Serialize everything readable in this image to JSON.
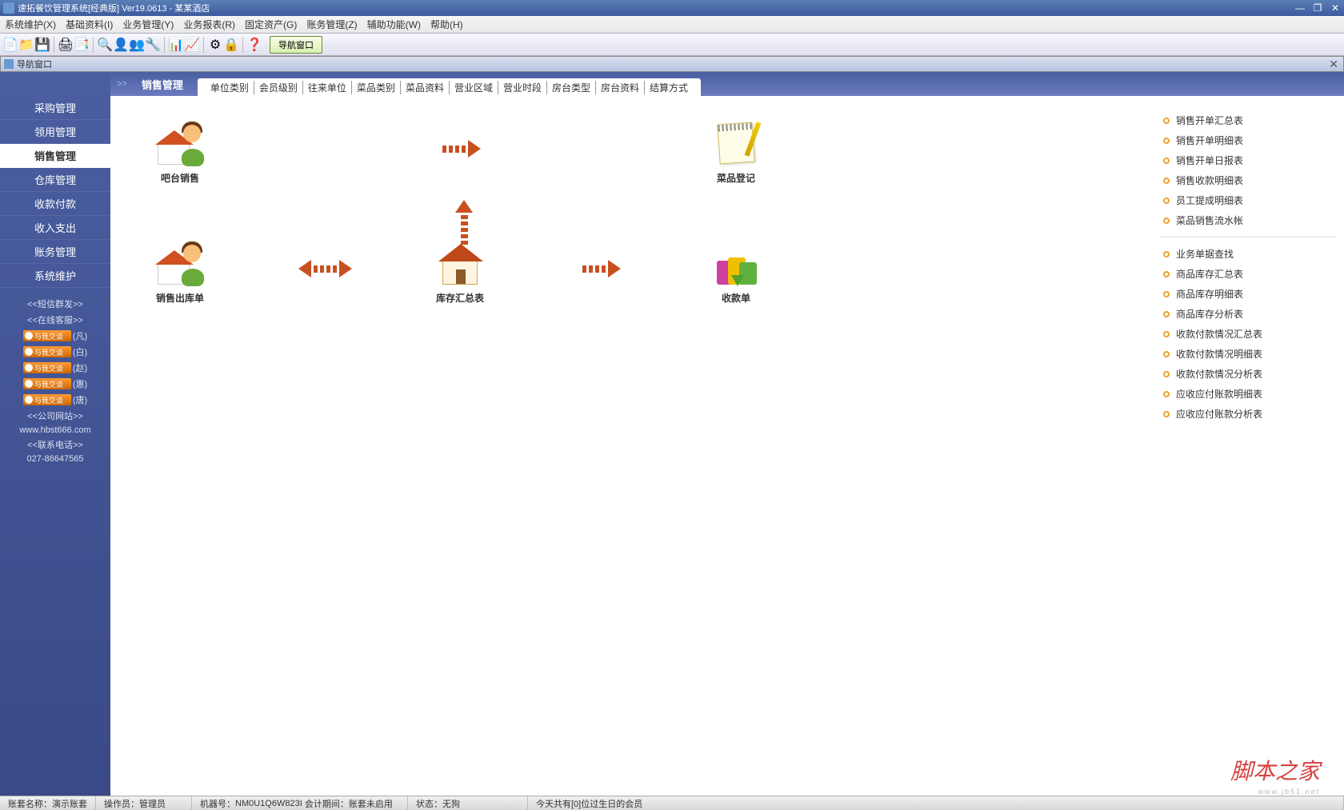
{
  "window": {
    "title": "速拓餐饮管理系统[经典版] Ver19.0613 - 某某酒店",
    "sub_title": "导航窗口"
  },
  "menu": [
    "系统维护(X)",
    "基础资料(I)",
    "业务管理(Y)",
    "业务报表(R)",
    "固定资产(G)",
    "账务管理(Z)",
    "辅助功能(W)",
    "帮助(H)"
  ],
  "toolbar_nav": "导航窗口",
  "sidebar": {
    "items": [
      "采购管理",
      "领用管理",
      "销售管理",
      "仓库管理",
      "收款付款",
      "收入支出",
      "账务管理",
      "系统维护"
    ],
    "active_index": 2,
    "sms": "<<短信群发>>",
    "online": "<<在线客服>>",
    "qq_text": "与我交谈",
    "qq": [
      "(凡)",
      "(白)",
      "(赵)",
      "(惠)",
      "(唐)"
    ],
    "site_label": "<<公司网站>>",
    "site_url": "www.hbst666.com",
    "tel_label": "<<联系电话>>",
    "tel": "027-86647565"
  },
  "header": {
    "prefix": ">>",
    "title": "销售管理",
    "tabs": [
      "单位类别",
      "会员级别",
      "往来单位",
      "菜品类别",
      "菜品资料",
      "营业区域",
      "营业时段",
      "房台类型",
      "房台资料",
      "结算方式"
    ]
  },
  "flow": {
    "n1": "吧台销售",
    "n2": "菜品登记",
    "n3": "销售出库单",
    "n4": "库存汇总表",
    "n5": "收款单"
  },
  "reports": {
    "g1": [
      "销售开单汇总表",
      "销售开单明细表",
      "销售开单日报表",
      "销售收款明细表",
      "员工提成明细表",
      "菜品销售流水帐"
    ],
    "g2": [
      "业务单据查找",
      "商品库存汇总表",
      "商品库存明细表",
      "商品库存分析表",
      "收款付款情况汇总表",
      "收款付款情况明细表",
      "收款付款情况分析表",
      "应收应付账款明细表",
      "应收应付账款分析表"
    ]
  },
  "status": {
    "account_label": "账套名称：",
    "account": "演示账套",
    "operator_label": "操作员：",
    "operator": "管理员",
    "machine_label": "机器号：",
    "machine": "NM0U1Q6W823I",
    "period_label": "会计期间：",
    "period": "账套未启用",
    "state_label": "状态：",
    "state": "无狗",
    "birthday": "今天共有[0]位过生日的会员"
  },
  "watermark": {
    "main": "脚本之家",
    "sub": "www.jb51.net"
  }
}
